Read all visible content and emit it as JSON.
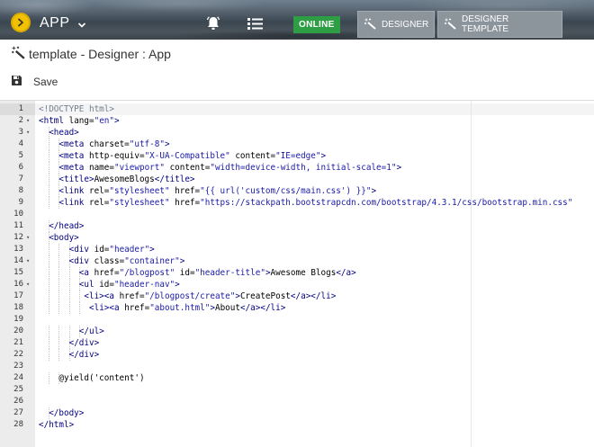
{
  "topbar": {
    "app_title": "APP",
    "status_badge": "ONLINE",
    "tabs": [
      {
        "label": "DESIGNER"
      },
      {
        "label": "DESIGNER TEMPLATE"
      }
    ]
  },
  "page": {
    "title": "template - Designer : App",
    "save_label": "Save"
  },
  "colors": {
    "logo": "#f2c200",
    "online": "#2e9e44",
    "tag": "#000080",
    "string": "#1a1aa6"
  },
  "icons": {
    "logo": "chevron-right-icon",
    "dropdown": "chevron-down-icon",
    "notifications": "bell-icon",
    "menu": "list-icon",
    "designer": "magic-wand-icon",
    "save": "floppy-disk-icon"
  },
  "editor": {
    "active_line": 1,
    "lines": [
      {
        "n": "1",
        "fold": false,
        "indent": 0,
        "tokens": [
          [
            "doc",
            "<!DOCTYPE html>"
          ]
        ]
      },
      {
        "n": "2",
        "fold": true,
        "indent": 0,
        "tokens": [
          [
            "tag",
            "<html "
          ],
          [
            "attr",
            "lang="
          ],
          [
            "str",
            "\"en\""
          ],
          [
            "tag",
            ">"
          ]
        ]
      },
      {
        "n": "3",
        "fold": true,
        "indent": 1,
        "tokens": [
          [
            "tag",
            "<head>"
          ]
        ]
      },
      {
        "n": "4",
        "fold": false,
        "indent": 2,
        "tokens": [
          [
            "tag",
            "<meta "
          ],
          [
            "attr",
            "charset="
          ],
          [
            "str",
            "\"utf-8\""
          ],
          [
            "tag",
            ">"
          ]
        ]
      },
      {
        "n": "5",
        "fold": false,
        "indent": 2,
        "tokens": [
          [
            "tag",
            "<meta "
          ],
          [
            "attr",
            "http-equiv="
          ],
          [
            "str",
            "\"X-UA-Compatible\""
          ],
          [
            "attr",
            " content="
          ],
          [
            "str",
            "\"IE=edge\""
          ],
          [
            "tag",
            ">"
          ]
        ]
      },
      {
        "n": "6",
        "fold": false,
        "indent": 2,
        "tokens": [
          [
            "tag",
            "<meta "
          ],
          [
            "attr",
            "name="
          ],
          [
            "str",
            "\"viewport\""
          ],
          [
            "attr",
            " content="
          ],
          [
            "str",
            "\"width=device-width, initial-scale=1\""
          ],
          [
            "tag",
            ">"
          ]
        ]
      },
      {
        "n": "7",
        "fold": false,
        "indent": 2,
        "tokens": [
          [
            "tag",
            "<title>"
          ],
          [
            "text",
            "AwesomeBlogs"
          ],
          [
            "tag",
            "</title>"
          ]
        ]
      },
      {
        "n": "8",
        "fold": false,
        "indent": 2,
        "tokens": [
          [
            "tag",
            "<link "
          ],
          [
            "attr",
            "rel="
          ],
          [
            "str",
            "\"stylesheet\""
          ],
          [
            "attr",
            " href="
          ],
          [
            "str",
            "\"{{ url('custom/css/main.css') }}\""
          ],
          [
            "tag",
            ">"
          ]
        ]
      },
      {
        "n": "9",
        "fold": false,
        "indent": 2,
        "tokens": [
          [
            "tag",
            "<link "
          ],
          [
            "attr",
            "rel="
          ],
          [
            "str",
            "\"stylesheet\""
          ],
          [
            "attr",
            " href="
          ],
          [
            "str",
            "\"https://stackpath.bootstrapcdn.com/bootstrap/4.3.1/css/bootstrap.min.css\""
          ]
        ]
      },
      {
        "n": "10",
        "fold": false,
        "indent": 0,
        "tokens": []
      },
      {
        "n": "11",
        "fold": false,
        "indent": 1,
        "tokens": [
          [
            "tag",
            "</head>"
          ]
        ]
      },
      {
        "n": "12",
        "fold": true,
        "indent": 1,
        "tokens": [
          [
            "tag",
            "<body>"
          ]
        ]
      },
      {
        "n": "13",
        "fold": false,
        "indent": 3,
        "tokens": [
          [
            "tag",
            "<div "
          ],
          [
            "attr",
            "id="
          ],
          [
            "str",
            "\"header\""
          ],
          [
            "tag",
            ">"
          ]
        ]
      },
      {
        "n": "14",
        "fold": true,
        "indent": 3,
        "tokens": [
          [
            "tag",
            "<div "
          ],
          [
            "attr",
            "class="
          ],
          [
            "str",
            "\"container\""
          ],
          [
            "tag",
            ">"
          ]
        ]
      },
      {
        "n": "15",
        "fold": false,
        "indent": 4,
        "tokens": [
          [
            "tag",
            "<a "
          ],
          [
            "attr",
            "href="
          ],
          [
            "str",
            "\"/blogpost\""
          ],
          [
            "attr",
            " id="
          ],
          [
            "str",
            "\"header-title\""
          ],
          [
            "tag",
            ">"
          ],
          [
            "text",
            "Awesome Blogs"
          ],
          [
            "tag",
            "</a>"
          ]
        ]
      },
      {
        "n": "16",
        "fold": true,
        "indent": 4,
        "tokens": [
          [
            "tag",
            "<ul "
          ],
          [
            "attr",
            "id="
          ],
          [
            "str",
            "\"header-nav\""
          ],
          [
            "tag",
            ">"
          ]
        ]
      },
      {
        "n": "17",
        "fold": false,
        "indent": 4,
        "pad": 1,
        "tokens": [
          [
            "tag",
            "<li><a "
          ],
          [
            "attr",
            "href="
          ],
          [
            "str",
            "\"/blogpost/create\""
          ],
          [
            "tag",
            ">"
          ],
          [
            "text",
            "CreatePost"
          ],
          [
            "tag",
            "</a></li>"
          ]
        ]
      },
      {
        "n": "18",
        "fold": false,
        "indent": 4,
        "pad": 2,
        "tokens": [
          [
            "tag",
            "<li><a "
          ],
          [
            "attr",
            "href="
          ],
          [
            "str",
            "\"about.html\""
          ],
          [
            "tag",
            ">"
          ],
          [
            "text",
            "About"
          ],
          [
            "tag",
            "</a></li>"
          ]
        ]
      },
      {
        "n": "19",
        "fold": false,
        "indent": 0,
        "tokens": []
      },
      {
        "n": "20",
        "fold": false,
        "indent": 4,
        "tokens": [
          [
            "tag",
            "</ul>"
          ]
        ]
      },
      {
        "n": "21",
        "fold": false,
        "indent": 3,
        "tokens": [
          [
            "tag",
            "</div>"
          ]
        ]
      },
      {
        "n": "22",
        "fold": false,
        "indent": 3,
        "tokens": [
          [
            "tag",
            "</div>"
          ]
        ]
      },
      {
        "n": "23",
        "fold": false,
        "indent": 0,
        "tokens": []
      },
      {
        "n": "24",
        "fold": false,
        "indent": 2,
        "tokens": [
          [
            "text",
            "@yield('content')"
          ]
        ]
      },
      {
        "n": "25",
        "fold": false,
        "indent": 0,
        "tokens": []
      },
      {
        "n": "26",
        "fold": false,
        "indent": 0,
        "tokens": []
      },
      {
        "n": "27",
        "fold": false,
        "indent": 1,
        "tokens": [
          [
            "tag",
            "</body>"
          ]
        ]
      },
      {
        "n": "28",
        "fold": false,
        "indent": 0,
        "tokens": [
          [
            "tag",
            "</html>"
          ]
        ]
      }
    ]
  }
}
